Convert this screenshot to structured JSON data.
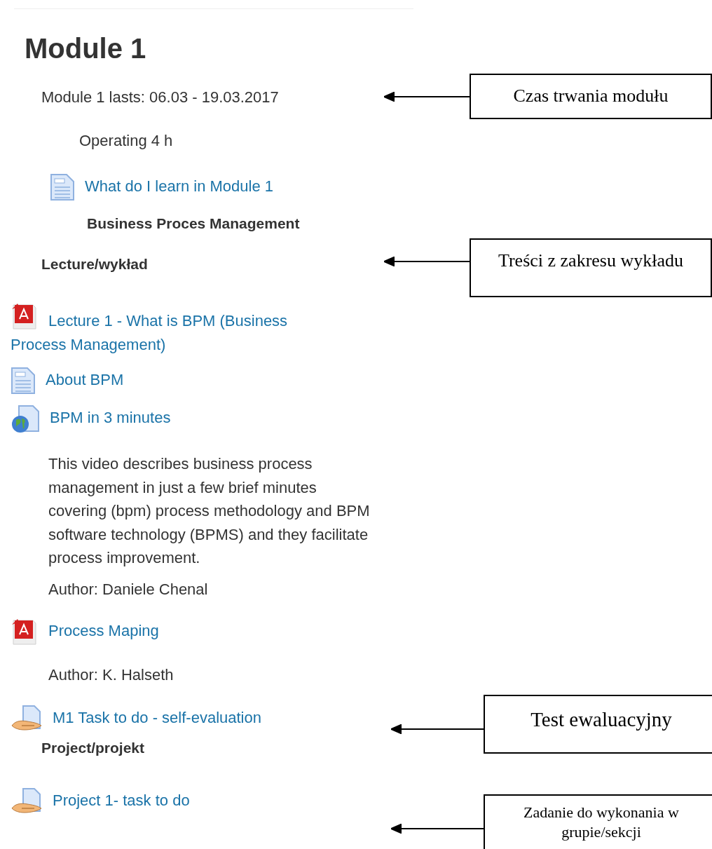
{
  "title": "Module 1",
  "duration": "Module 1 lasts: 06.03 - 19.03.2017",
  "hours": "Operating 4 h",
  "intro_link": {
    "kind": "page",
    "label": "What do I learn in Module 1"
  },
  "topic": "Business Proces Management",
  "sections": [
    {
      "heading": "Lecture/wykład",
      "activities": [
        {
          "kind": "pdf",
          "label": "Lecture 1 - What is BPM (Business Process Management)"
        },
        {
          "kind": "page",
          "label": "About BPM"
        },
        {
          "kind": "url",
          "label": "BPM in 3 minutes",
          "description": "This video describes business process management in just a few brief minutes covering (bpm) process methodology and BPM software technology (BPMS) and they facilitate process improvement.",
          "author": "Author: Daniele Chenal"
        },
        {
          "kind": "pdf",
          "label": "Process Maping",
          "author": "Author: K. Halseth"
        },
        {
          "kind": "assign",
          "label": "M1 Task to do - self-evaluation"
        }
      ]
    },
    {
      "heading": "Project/projekt",
      "activities": [
        {
          "kind": "assign",
          "label": "Project 1- task to do"
        }
      ]
    }
  ],
  "callouts": [
    {
      "text": "Czas trwania modułu"
    },
    {
      "text": "Treści z zakresu wykładu"
    },
    {
      "text": "Test ewaluacyjny"
    },
    {
      "text": "Zadanie do wykonania w grupie/sekcji"
    }
  ]
}
